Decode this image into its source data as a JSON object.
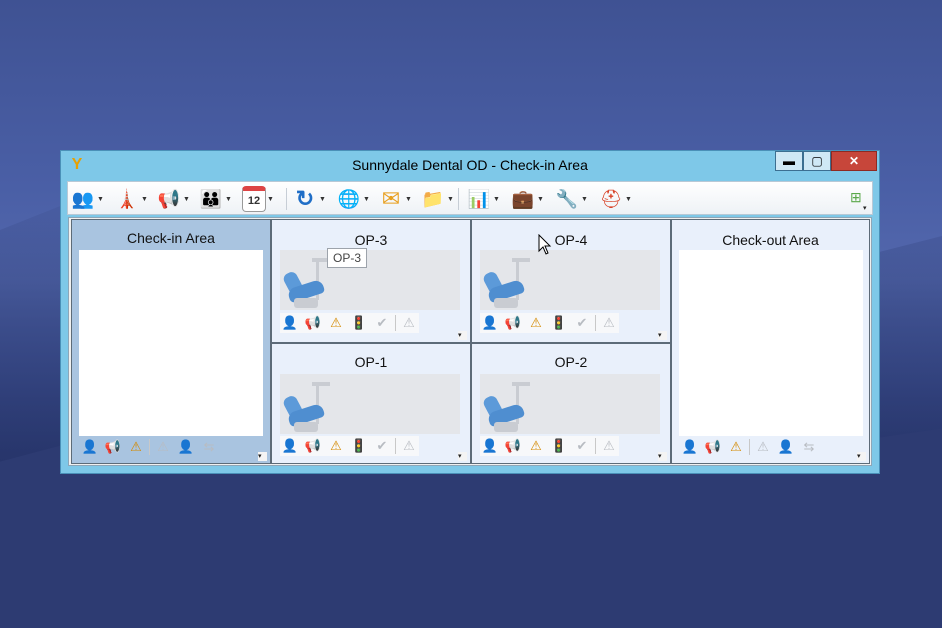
{
  "window": {
    "title": "Sunnydale Dental OD - Check-in Area",
    "controls": {
      "minimize": "▬",
      "maximize": "▢",
      "close": "✕"
    }
  },
  "toolbar": {
    "buttons": [
      {
        "name": "patients",
        "glyph": "👥"
      },
      {
        "name": "broadcast",
        "glyph": "🗼"
      },
      {
        "name": "announce",
        "glyph": "📢"
      },
      {
        "name": "staff",
        "glyph": "👪"
      },
      {
        "name": "calendar",
        "glyph": "12"
      },
      {
        "name": "refresh",
        "glyph": "↻"
      },
      {
        "name": "internet",
        "glyph": "🌐"
      },
      {
        "name": "mail",
        "glyph": "✉"
      },
      {
        "name": "folder",
        "glyph": "📁"
      },
      {
        "name": "reports",
        "glyph": "📊"
      },
      {
        "name": "briefcase",
        "glyph": "💼"
      },
      {
        "name": "tools",
        "glyph": "🔧"
      },
      {
        "name": "help",
        "glyph": "⛑"
      }
    ],
    "collapse_glyph": "⊞"
  },
  "panes": {
    "checkin": {
      "title": "Check-in Area"
    },
    "checkout": {
      "title": "Check-out Area"
    },
    "op3": {
      "title": "OP-3"
    },
    "op4": {
      "title": "OP-4"
    },
    "op1": {
      "title": "OP-1"
    },
    "op2": {
      "title": "OP-2"
    }
  },
  "tooltip": {
    "text": "OP-3"
  },
  "icons": {
    "person": "👤",
    "megaphone": "📢",
    "warning": "⚠",
    "traffic": "🚦",
    "check": "✔",
    "transfer": "⇆",
    "scroll_down": "▾"
  }
}
